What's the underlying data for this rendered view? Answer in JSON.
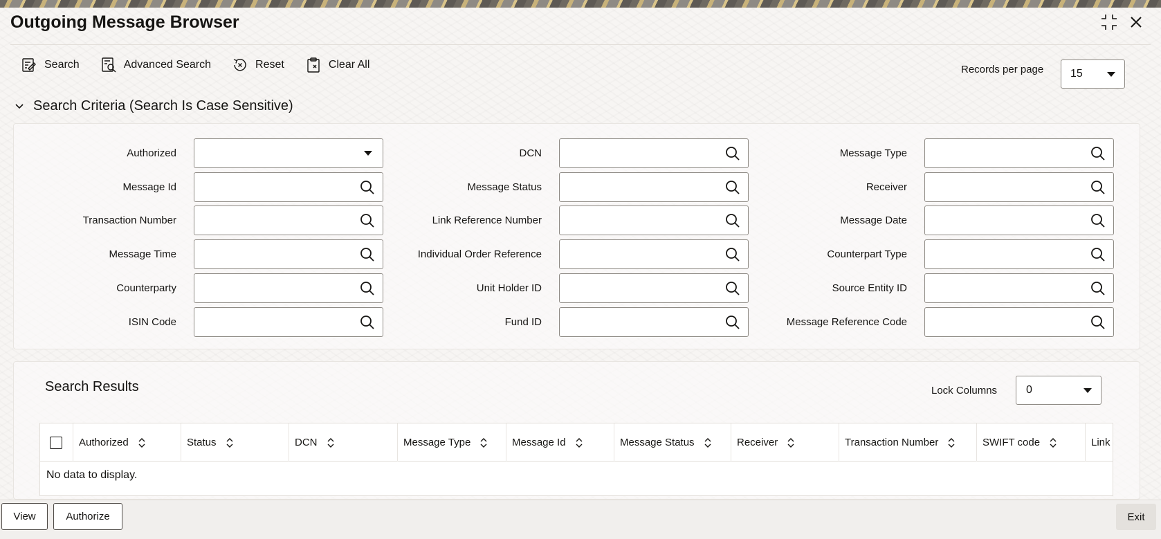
{
  "window": {
    "title": "Outgoing Message Browser"
  },
  "toolbar": {
    "search_label": "Search",
    "advanced_search_label": "Advanced Search",
    "reset_label": "Reset",
    "clear_all_label": "Clear All",
    "records_per_page_label": "Records per page",
    "records_per_page_value": "15"
  },
  "criteria": {
    "header": "Search Criteria (Search Is Case Sensitive)",
    "fields": [
      {
        "label": "Authorized",
        "value": "",
        "type": "select"
      },
      {
        "label": "DCN",
        "value": "",
        "type": "lookup"
      },
      {
        "label": "Message Type",
        "value": "",
        "type": "lookup"
      },
      {
        "label": "Message Id",
        "value": "",
        "type": "lookup"
      },
      {
        "label": "Message Status",
        "value": "",
        "type": "lookup"
      },
      {
        "label": "Receiver",
        "value": "",
        "type": "lookup"
      },
      {
        "label": "Transaction Number",
        "value": "",
        "type": "lookup"
      },
      {
        "label": "Link Reference Number",
        "value": "",
        "type": "lookup"
      },
      {
        "label": "Message Date",
        "value": "",
        "type": "lookup"
      },
      {
        "label": "Message Time",
        "value": "",
        "type": "lookup"
      },
      {
        "label": "Individual Order Reference",
        "value": "",
        "type": "lookup"
      },
      {
        "label": "Counterpart Type",
        "value": "",
        "type": "lookup"
      },
      {
        "label": "Counterparty",
        "value": "",
        "type": "lookup"
      },
      {
        "label": "Unit Holder ID",
        "value": "",
        "type": "lookup"
      },
      {
        "label": "Source Entity ID",
        "value": "",
        "type": "lookup"
      },
      {
        "label": "ISIN Code",
        "value": "",
        "type": "lookup"
      },
      {
        "label": "Fund ID",
        "value": "",
        "type": "lookup"
      },
      {
        "label": "Message Reference Code",
        "value": "",
        "type": "lookup"
      }
    ]
  },
  "results": {
    "title": "Search Results",
    "lock_columns_label": "Lock Columns",
    "lock_columns_value": "0",
    "columns": [
      "Authorized",
      "Status",
      "DCN",
      "Message Type",
      "Message Id",
      "Message Status",
      "Receiver",
      "Transaction Number",
      "SWIFT code",
      "Link"
    ],
    "empty_text": "No data to display."
  },
  "footer": {
    "view_label": "View",
    "authorize_label": "Authorize",
    "exit_label": "Exit"
  },
  "colors": {
    "text": "#161513",
    "border": "#8e8a84",
    "background": "#f7f5f3"
  }
}
